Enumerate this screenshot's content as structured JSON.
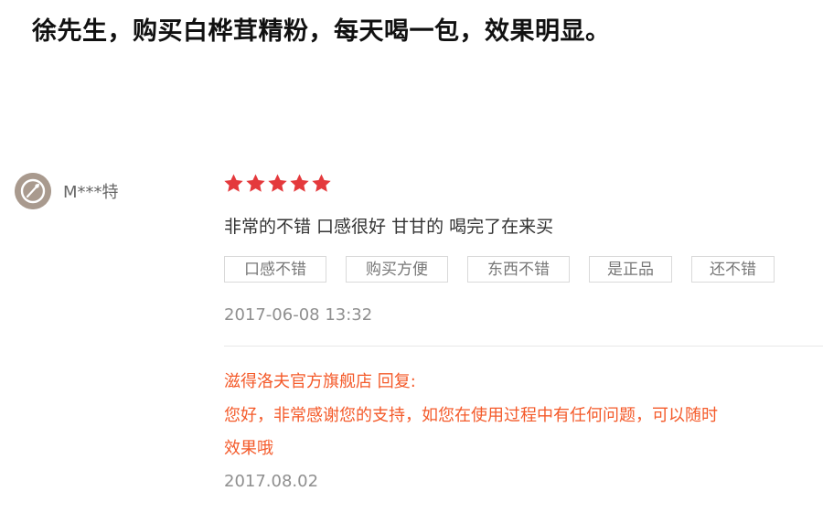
{
  "headline": "徐先生，购买白桦茸精粉，每天喝一包，效果明显。",
  "review": {
    "avatar_icon": "user-avatar-icon",
    "username": "M***特",
    "rating": 5,
    "rating_max": 5,
    "star_color": "#e4393c",
    "text": "非常的不错 口感很好 甘甘的 喝完了在来买",
    "tags": [
      "口感不错",
      "购买方便",
      "东西不错",
      "是正品",
      "还不错"
    ],
    "date": "2017-06-08 13:32"
  },
  "reply": {
    "title": "滋得洛夫官方旗舰店 回复:",
    "line1": "您好，非常感谢您的支持，如您在使用过程中有任何问题，可以随时",
    "line2": "效果哦",
    "date": "2017.08.02",
    "color": "#f45a2a"
  }
}
